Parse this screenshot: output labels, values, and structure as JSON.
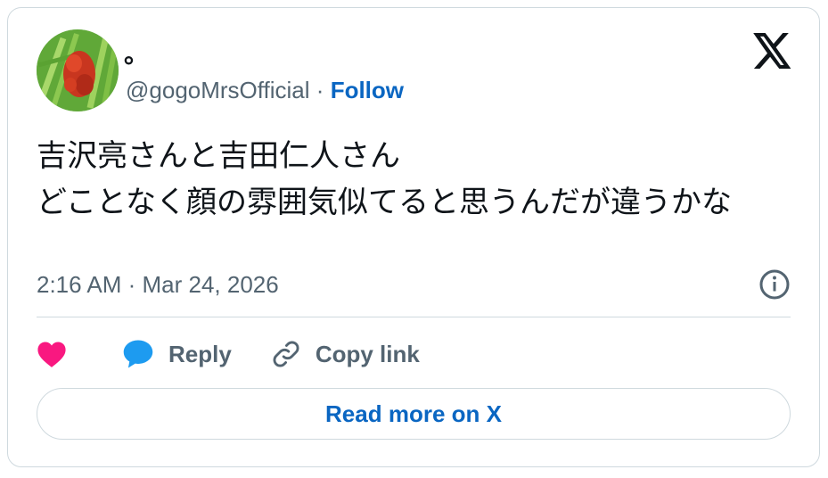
{
  "author": {
    "display_name": "。",
    "handle": "@gogoMrsOfficial",
    "separator": "·",
    "follow_label": "Follow"
  },
  "tweet": {
    "text": "吉沢亮さんと吉田仁人さん\nどことなく顔の雰囲気似てると思うんだが違うかな",
    "timestamp": "2:16 AM · Mar 24, 2026"
  },
  "actions": {
    "reply_label": "Reply",
    "copy_link_label": "Copy link"
  },
  "read_more_label": "Read more on X",
  "colors": {
    "like": "#f91880",
    "reply": "#1d9bf0",
    "link": "#0a66c2",
    "muted": "#536471",
    "border": "#cfd9de"
  },
  "icons": [
    "avatar-image",
    "x-logo-icon",
    "info-icon",
    "heart-icon",
    "reply-bubble-icon",
    "link-icon"
  ]
}
